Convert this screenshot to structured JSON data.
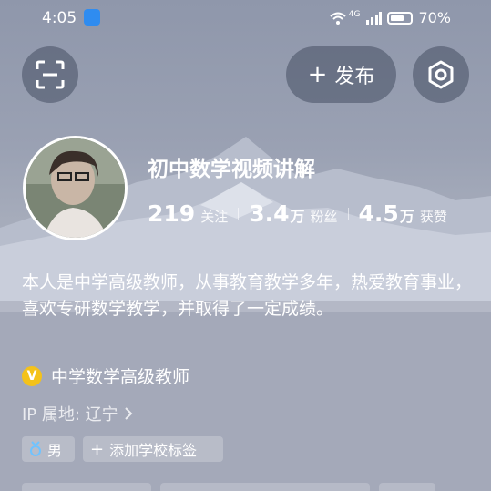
{
  "status_bar": {
    "time": "4:05",
    "network": "4G",
    "battery": "70%"
  },
  "header": {
    "publish_label": "发布"
  },
  "profile": {
    "name": "初中数学视频讲解",
    "stats": [
      {
        "value": "219",
        "unit": "",
        "label": "关注"
      },
      {
        "value": "3.4",
        "unit": "万",
        "label": "粉丝"
      },
      {
        "value": "4.5",
        "unit": "万",
        "label": "获赞"
      }
    ],
    "bio": "本人是中学高级教师，从事教育教学多年，热爱教育事业，喜欢专研数学教学，并取得了一定成绩。",
    "verification_badge": "V",
    "verification": "中学数学高级教师",
    "ip_location": "IP 属地: 辽宁",
    "tags": {
      "gender": "男",
      "add_school": "添加学校标签"
    }
  },
  "colors": {
    "overlay": "#464e62",
    "verify_badge": "#f4c21a",
    "app_badge": "#2f8cf0"
  }
}
